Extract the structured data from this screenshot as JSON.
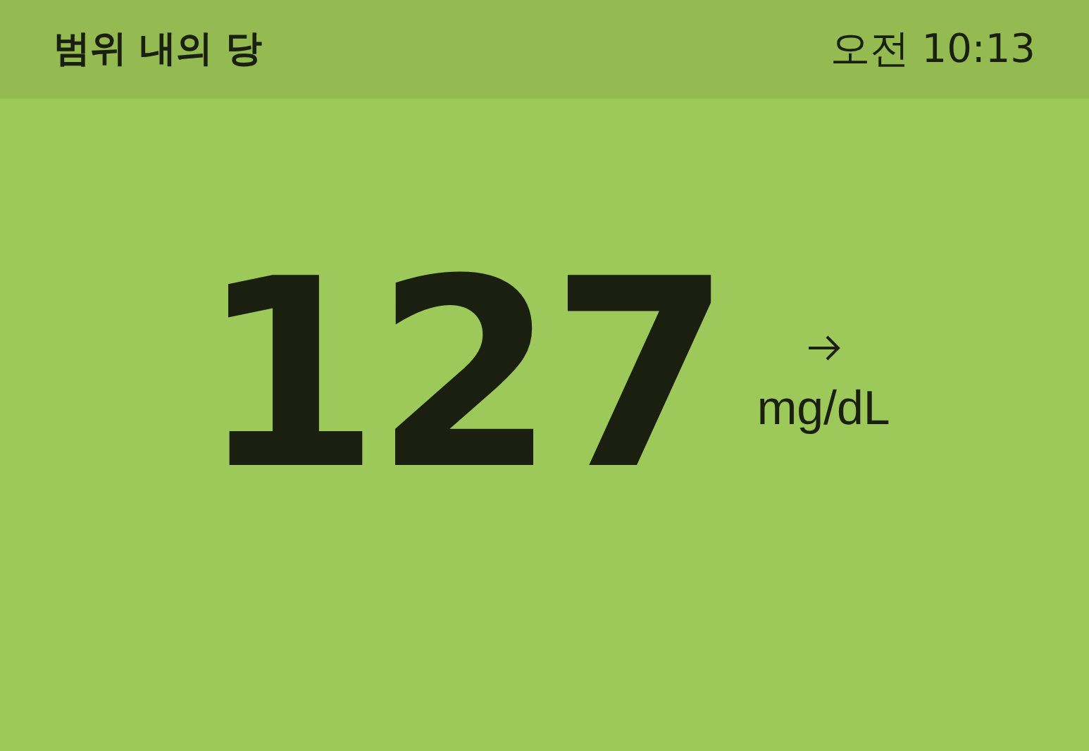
{
  "header": {
    "title": "범위 내의 당",
    "time": "오전 10:13"
  },
  "reading": {
    "value": "127",
    "unit": "mg/dL"
  }
}
